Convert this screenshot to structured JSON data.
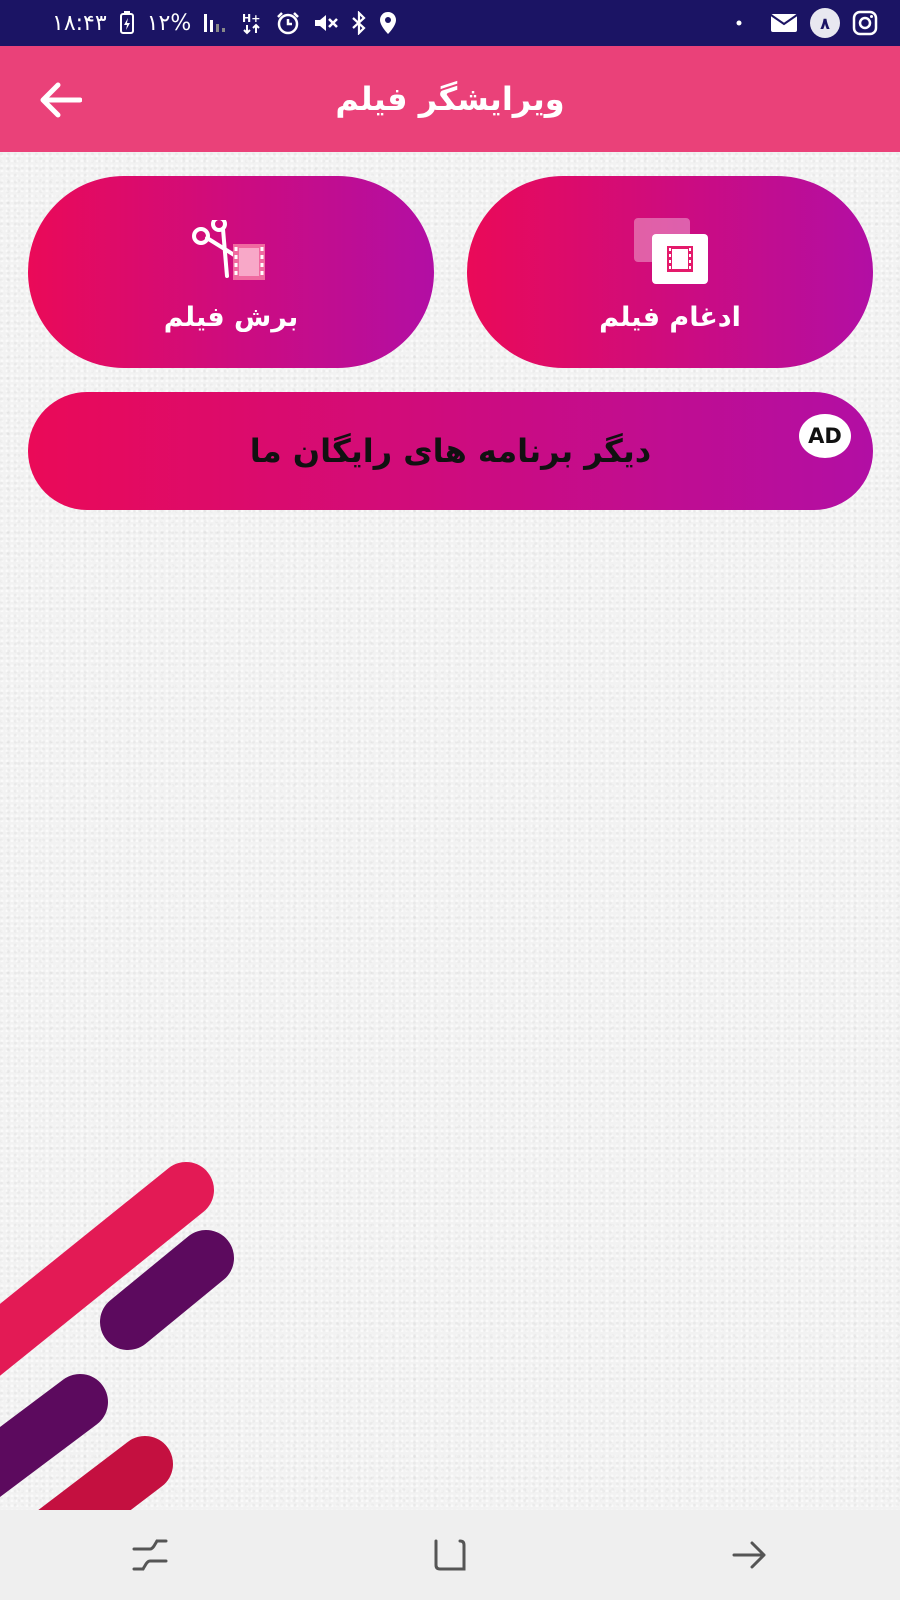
{
  "status_bar": {
    "time": "۱۸:۴۳",
    "battery": "۱۲%",
    "notification_count": "۸",
    "left_icons": [
      "battery-icon",
      "signal-icon",
      "data-icon",
      "alarm-icon",
      "mute-icon",
      "bluetooth-icon",
      "location-icon"
    ],
    "right_icons": [
      "dot-icon",
      "mail-icon",
      "instagram-icon"
    ]
  },
  "header": {
    "title": "ویرایشگر فیلم",
    "back_icon": "back-arrow-icon",
    "color": "#ea4179"
  },
  "actions": {
    "merge_label": "ادغام فیلم",
    "merge_icon": "merge-video-icon",
    "cut_label": "برش فیلم",
    "cut_icon": "scissors-film-icon"
  },
  "ad_banner": {
    "label": "دیگر برنامه های رایگان ما",
    "badge": "AD"
  },
  "nav_bar": {
    "icons": [
      "recents-icon",
      "home-icon",
      "back-icon"
    ]
  },
  "colors": {
    "status_bar": "#1b1464",
    "gradient_start": "#ea0a58",
    "gradient_end": "#b20ea4",
    "stripe_pink": "#e31a55",
    "stripe_purple": "#5c0a5e",
    "stripe_crimson": "#c41040"
  }
}
